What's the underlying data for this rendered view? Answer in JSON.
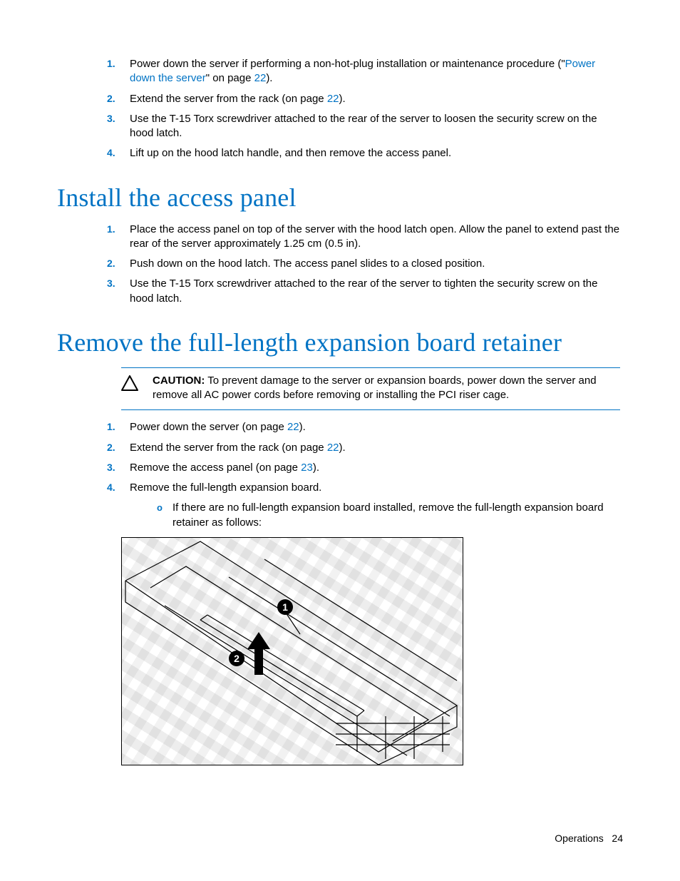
{
  "section1": {
    "steps": [
      {
        "pre": "Power down the server if performing a non-hot-plug installation or maintenance procedure (\"",
        "link": "Power down the server",
        "mid": "\" on page ",
        "page": "22",
        "post": ")."
      },
      {
        "pre": "Extend the server from the rack (on page ",
        "page": "22",
        "post": ")."
      },
      {
        "text": "Use the T-15 Torx screwdriver attached to the rear of the server to loosen the security screw on the hood latch."
      },
      {
        "text": "Lift up on the hood latch handle, and then remove the access panel."
      }
    ]
  },
  "section2": {
    "heading": "Install the access panel",
    "steps": [
      {
        "text": "Place the access panel on top of the server with the hood latch open. Allow the panel to extend past the rear of the server approximately 1.25 cm (0.5 in)."
      },
      {
        "text": "Push down on the hood latch. The access panel slides to a closed position."
      },
      {
        "text": "Use the T-15 Torx screwdriver attached to the rear of the server to tighten the security screw on the hood latch."
      }
    ]
  },
  "section3": {
    "heading": "Remove the full-length expansion board retainer",
    "caution": {
      "label": "CAUTION:",
      "text": " To prevent damage to the server or expansion boards, power down the server and remove all AC power cords before removing or installing the PCI riser cage."
    },
    "steps": [
      {
        "pre": "Power down the server (on page ",
        "page": "22",
        "post": ")."
      },
      {
        "pre": "Extend the server from the rack (on page ",
        "page": "22",
        "post": ")."
      },
      {
        "pre": "Remove the access panel (on page ",
        "page": "23",
        "post": ")."
      },
      {
        "text": "Remove the full-length expansion board.",
        "sub": "If there are no full-length expansion board installed, remove the full-length expansion board retainer as follows:"
      }
    ]
  },
  "figure": {
    "callout1": "1",
    "callout2": "2"
  },
  "footer": {
    "section": "Operations",
    "page": "24"
  }
}
